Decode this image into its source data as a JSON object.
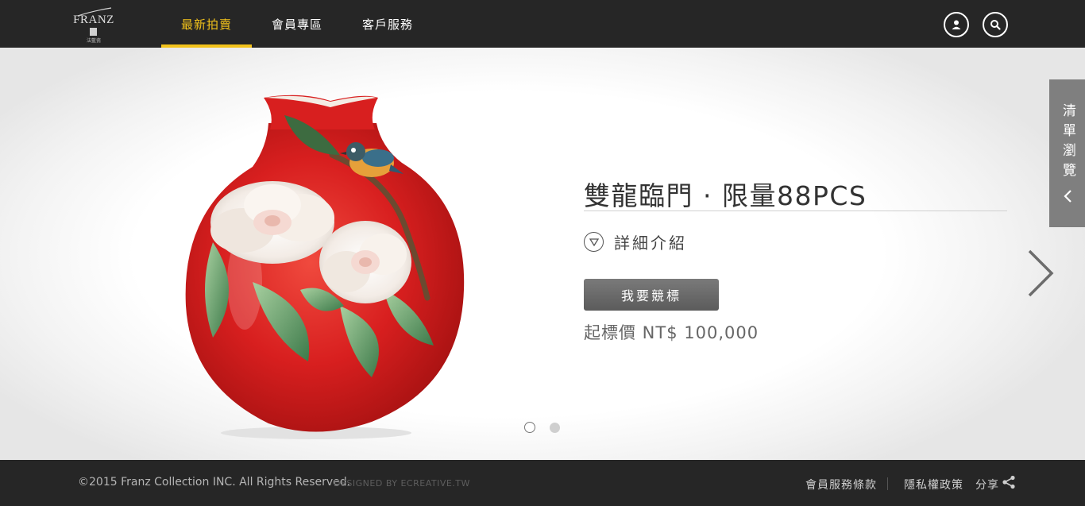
{
  "header": {
    "logo": {
      "word": "FRANZ",
      "sub": "法藍瓷"
    },
    "nav": [
      {
        "label": "最新拍賣",
        "active": true
      },
      {
        "label": "會員專區",
        "active": false
      },
      {
        "label": "客戶服務",
        "active": false
      }
    ],
    "icons": {
      "user": "user-icon",
      "search": "search-icon"
    }
  },
  "hero": {
    "product_title": "雙龍臨門 · 限量88PCS",
    "detail_label": "詳細介紹",
    "bid_button": "我要競標",
    "start_price": "起標價 NT$ 100,000",
    "slides": {
      "count": 2,
      "active": 1
    },
    "side_tab": {
      "label": "清單瀏覽",
      "icon": "chevron-left-icon"
    },
    "next_icon": "chevron-right-icon"
  },
  "footer": {
    "copyright": "©2015 Franz Collection INC. All Rights Reserved.",
    "designed_by": "DESIGNED BY ECREATIVE.TW",
    "links": {
      "terms": "會員服務條款",
      "privacy": "隱私權政策",
      "share": "分享"
    }
  },
  "colors": {
    "header_bg": "#262626",
    "accent": "#f2c21b",
    "vase_red": "#d81f1f",
    "button_gray": "#6a6a6a",
    "side_tab_gray": "#7f7f7f"
  }
}
